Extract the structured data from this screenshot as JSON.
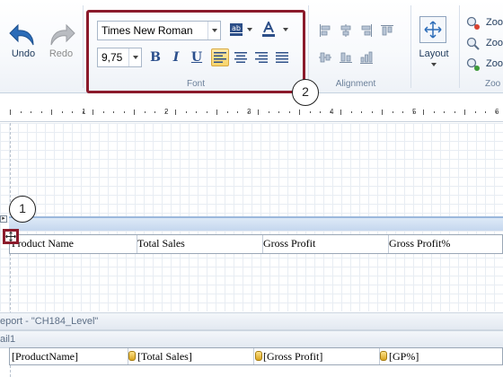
{
  "ribbon": {
    "undo_label": "Undo",
    "redo_label": "Redo",
    "font_name": "Times New Roman",
    "font_size": "9,75",
    "bold_glyph": "B",
    "italic_glyph": "I",
    "underline_glyph": "U",
    "font_group_label": "Font",
    "alignment_group_label": "Alignment",
    "layout_label": "Layout",
    "zoom_labels": [
      "Zoo",
      "Zoo",
      "Zoo"
    ],
    "zoom_group_label": "Zoo"
  },
  "callouts": {
    "one": "1",
    "two": "2"
  },
  "ruler": {
    "numbers": [
      "1",
      "2",
      "3",
      "4",
      "5",
      "6"
    ]
  },
  "table": {
    "headers": [
      "Product Name",
      "Total Sales",
      "Gross Profit",
      "Gross Profit%"
    ]
  },
  "report_band_label": "eport - \"CH184_Level\"",
  "detail_band_label": "ail1",
  "detail": {
    "cells": [
      "[ProductName]",
      "[Total Sales]",
      "[Gross Profit]",
      "[GP%]"
    ]
  },
  "colors": {
    "highlight": "#8b1a2b",
    "ribbon_text": "#1e395b",
    "active_button": "#f8d46a"
  }
}
